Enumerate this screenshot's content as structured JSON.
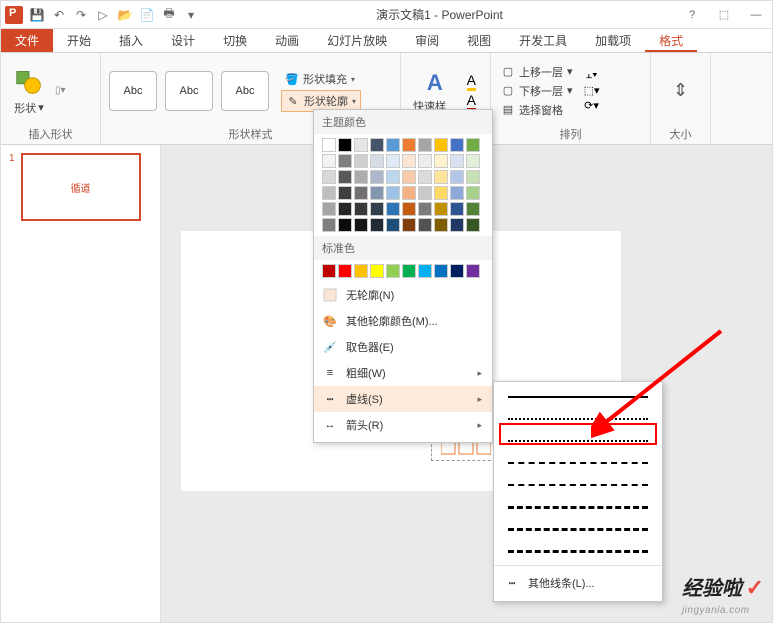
{
  "title": "演示文稿1 - PowerPoint",
  "qat": {
    "save": "💾",
    "undo": "↶",
    "redo": "↷",
    "start": "▷",
    "open": "📂",
    "new": "📄",
    "print": "🖶"
  },
  "tabs": {
    "file": "文件",
    "home": "开始",
    "insert": "插入",
    "design": "设计",
    "transitions": "切换",
    "animations": "动画",
    "slideshow": "幻灯片放映",
    "review": "审阅",
    "view": "视图",
    "developer": "开发工具",
    "addins": "加载项",
    "format": "格式"
  },
  "ribbon": {
    "insertShapes": {
      "shape": "形状",
      "label": "插入形状"
    },
    "shapeStyles": {
      "sample": "Abc",
      "fill": "形状填充",
      "outline": "形状轮廓",
      "label": "形状样式"
    },
    "wordart": {
      "quick": "快速样式"
    },
    "arrange": {
      "bringForward": "上移一层",
      "sendBackward": "下移一层",
      "selectionPane": "选择窗格",
      "label": "排列"
    },
    "size": {
      "label": "大小"
    }
  },
  "outlineMenu": {
    "themeColors": "主题颜色",
    "standardColors": "标准色",
    "noOutline": "无轮廓(N)",
    "moreColors": "其他轮廓颜色(M)...",
    "eyedropper": "取色器(E)",
    "weight": "粗细(W)",
    "dashes": "虚线(S)",
    "arrows": "箭头(R)",
    "themeGrid": [
      [
        "#FFFFFF",
        "#000000",
        "#E7E6E6",
        "#44546A",
        "#5B9BD5",
        "#ED7D31",
        "#A5A5A5",
        "#FFC000",
        "#4472C4",
        "#70AD47"
      ],
      [
        "#F2F2F2",
        "#7F7F7F",
        "#D0CECE",
        "#D6DCE4",
        "#DEEBF6",
        "#FBE5D5",
        "#EDEDED",
        "#FFF2CC",
        "#D9E2F3",
        "#E2EFD9"
      ],
      [
        "#D8D8D8",
        "#595959",
        "#AEABAB",
        "#ADB9CA",
        "#BDD7EE",
        "#F7CBAC",
        "#DBDBDB",
        "#FEE599",
        "#B4C6E7",
        "#C5E0B3"
      ],
      [
        "#BFBFBF",
        "#3F3F3F",
        "#757070",
        "#8496B0",
        "#9CC3E5",
        "#F4B183",
        "#C9C9C9",
        "#FFD965",
        "#8EAADB",
        "#A8D08D"
      ],
      [
        "#A5A5A5",
        "#262626",
        "#3A3838",
        "#323F4F",
        "#2E75B5",
        "#C55A11",
        "#7B7B7B",
        "#BF9000",
        "#2F5496",
        "#538135"
      ],
      [
        "#7F7F7F",
        "#0C0C0C",
        "#171616",
        "#222A35",
        "#1E4E79",
        "#833C0B",
        "#525252",
        "#7F6000",
        "#1F3864",
        "#375623"
      ]
    ],
    "standardGrid": [
      "#C00000",
      "#FF0000",
      "#FFC000",
      "#FFFF00",
      "#92D050",
      "#00B050",
      "#00B0F0",
      "#0070C0",
      "#002060",
      "#7030A0"
    ]
  },
  "dashMenu": {
    "moreLines": "其他线条(L)...",
    "styles": [
      "solid",
      "round-dot",
      "square-dot",
      "dash",
      "dash-dot",
      "long-dash",
      "long-dash-dot",
      "long-dash-dot-dot"
    ]
  },
  "thumb": {
    "num": "1",
    "title": "循道"
  },
  "watermark": {
    "brand": "经验啦",
    "url": "jingyanla.com"
  }
}
